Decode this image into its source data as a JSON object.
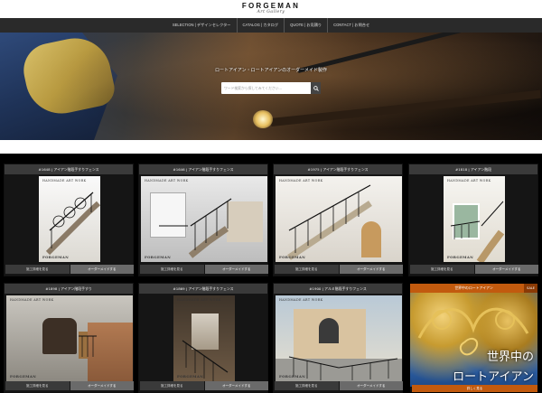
{
  "brand": {
    "name": "FORGEMAN",
    "sub": "Art Gallery"
  },
  "nav": [
    "SELECTION | デザインセレクター",
    "CATALOG | カタログ",
    "QUOTE | お見積り",
    "CONTACT | お問合せ"
  ],
  "hero": {
    "tagline": "ロートアイアン・ロートアイアンのオーダーメイド製作",
    "search_placeholder": "ワード検索から探してみてください..."
  },
  "cards": [
    {
      "title": "#1648 | アイアン階段手すりフェンス",
      "btn_detail": "施工詳細を見る",
      "btn_order": "オーダーメイドする"
    },
    {
      "title": "#1646 | アイアン階段手すりフェンス",
      "btn_detail": "施工詳細を見る",
      "btn_order": "オーダーメイドする"
    },
    {
      "title": "#1975 | アイアン階段手すりフェンス",
      "btn_detail": "施工詳細を見る",
      "btn_order": "オーダーメイドする"
    },
    {
      "title": "#1818 | アイアン階段",
      "btn_detail": "施工詳細を見る",
      "btn_order": "オーダーメイドする"
    },
    {
      "title": "#1898 | アイアン階段手すり",
      "btn_detail": "施工詳細を見る",
      "btn_order": "オーダーメイドする"
    },
    {
      "title": "#1869 | アイアン階段手すりフェンス",
      "btn_detail": "施工詳細を見る",
      "btn_order": "オーダーメイドする"
    },
    {
      "title": "#1900 | アルミ階段手すりフェンス",
      "btn_detail": "施工詳細を見る",
      "btn_order": "オーダーメイドする"
    }
  ],
  "watermark": {
    "title": "HANDMADE ART WORK",
    "brand": "FORGEMAN"
  },
  "promo": {
    "head": "世界中のロートアイアン",
    "tag": "SALE",
    "line1": "世界中の",
    "line2": "ロートアイアン",
    "button": "詳しく見る"
  },
  "colors": {
    "accent": "#c25a0e",
    "card_bar": "#3a3a3a",
    "nav_bg": "#2a2a2a"
  }
}
